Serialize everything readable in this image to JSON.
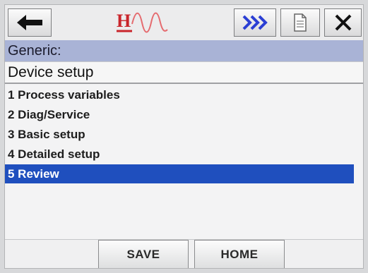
{
  "toolbar": {
    "back_icon": "left-arrow-icon",
    "logo_text": "H",
    "next_icon": "double-chevron-right-icon",
    "doc_icon": "document-icon",
    "close_icon": "close-x-icon",
    "colors": {
      "logo": "#c9252b",
      "next_icon": "#2b3fd4"
    }
  },
  "header": {
    "title": "Generic:",
    "subtitle": "Device setup"
  },
  "menu": {
    "items": [
      {
        "label": "1 Process variables"
      },
      {
        "label": "2 Diag/Service"
      },
      {
        "label": "3 Basic setup"
      },
      {
        "label": "4 Detailed setup"
      },
      {
        "label": "5 Review",
        "selected": true
      }
    ]
  },
  "footer": {
    "save_label": "SAVE",
    "home_label": "HOME"
  },
  "colors": {
    "title_bar": "#a9b3d6",
    "selection": "#1f4fbe"
  }
}
